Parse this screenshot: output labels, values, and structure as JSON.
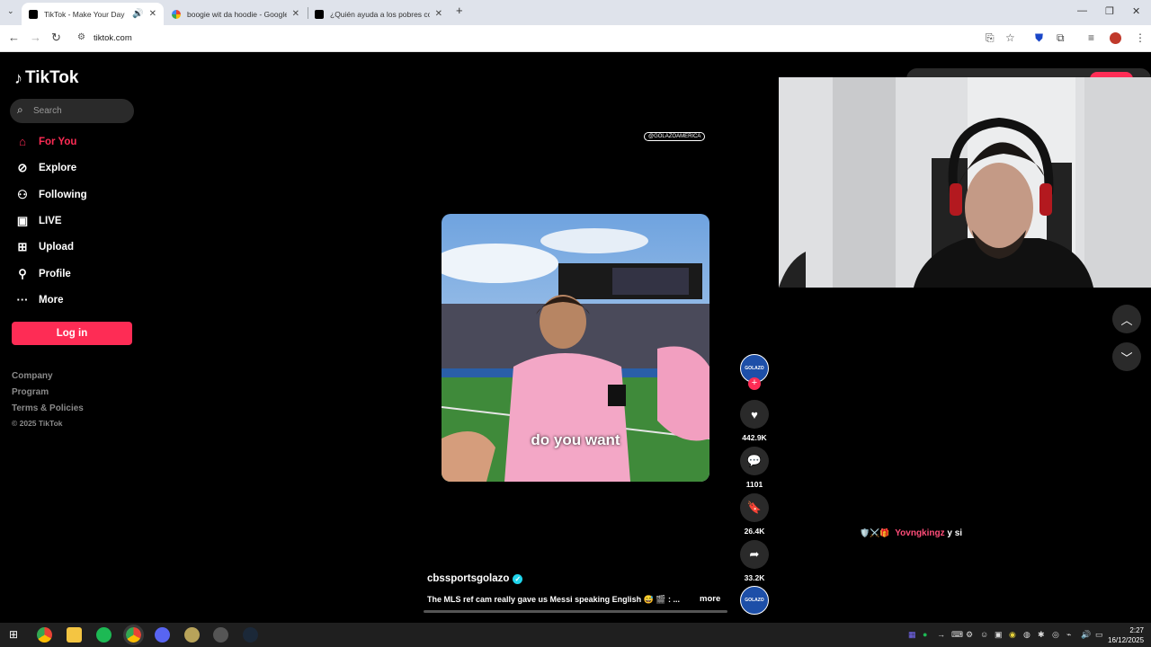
{
  "browser": {
    "tabs": [
      {
        "title": "TikTok - Make Your Day",
        "active": true
      },
      {
        "title": "boogie wit da hoodie - Google",
        "active": false
      },
      {
        "title": "¿Quién ayuda a los pobres con",
        "active": false
      }
    ],
    "url": "tiktok.com"
  },
  "tiktok": {
    "brand": "TikTok",
    "search_placeholder": "Search",
    "nav": [
      {
        "label": "For You",
        "icon": "home-icon",
        "active": true
      },
      {
        "label": "Explore",
        "icon": "compass-icon",
        "active": false
      },
      {
        "label": "Following",
        "icon": "person-icon",
        "active": false
      },
      {
        "label": "LIVE",
        "icon": "live-icon",
        "active": false
      },
      {
        "label": "Upload",
        "icon": "plus-box-icon",
        "active": false
      },
      {
        "label": "Profile",
        "icon": "person-icon",
        "active": false
      },
      {
        "label": "More",
        "icon": "ellipsis-icon",
        "active": false
      }
    ],
    "login_label": "Log in",
    "footer": {
      "company": "Company",
      "program": "Program",
      "terms": "Terms & Policies",
      "copyright": "© 2025 TikTok"
    },
    "video": {
      "watermark": "@GOLAZOAMERICA",
      "caption_overlay": "do you want",
      "author": "cbssportsgolazo",
      "description": "The MLS ref cam really gave us Messi speaking English 😅 🎬 : ...",
      "more_label": "more",
      "avatar_text": "GOLAZO",
      "likes": "442.9K",
      "comments": "1101",
      "saves": "26.4K",
      "shares": "33.2K"
    }
  },
  "chat": {
    "badges": "🛡️⚔️🎁",
    "username": "Yovngkingz",
    "message": "y si"
  },
  "taskbar": {
    "time": "2:27",
    "date": "16/12/2025"
  },
  "colors": {
    "tiktok_red": "#fe2c55",
    "verified": "#20d5ec"
  }
}
